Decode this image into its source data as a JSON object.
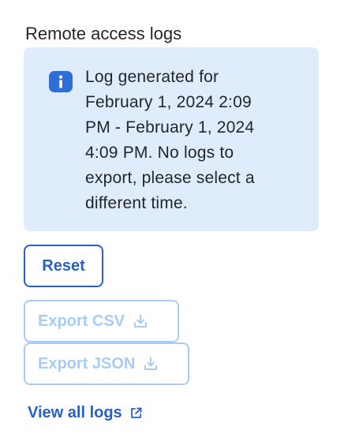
{
  "section": {
    "title": "Remote access logs"
  },
  "info": {
    "icon": "info-icon",
    "lines": [
      "Log generated for",
      "February 1, 2024 2:09",
      "PM - February 1, 2024",
      "4:09 PM. No logs to",
      "export, please select a",
      "different time."
    ]
  },
  "actions": {
    "reset_label": "Reset",
    "export_csv_label": "Export CSV",
    "export_csv_icon": "download-icon",
    "export_csv_disabled": true,
    "export_json_label": "Export JSON",
    "export_json_icon": "download-icon",
    "export_json_disabled": true
  },
  "link": {
    "label": "View all logs",
    "icon": "external-link-icon"
  },
  "colors": {
    "accent": "#2760c7",
    "disabled": "#a9ccf5",
    "info_background": "#dfecfb",
    "info_icon": "#2d6fd6"
  }
}
